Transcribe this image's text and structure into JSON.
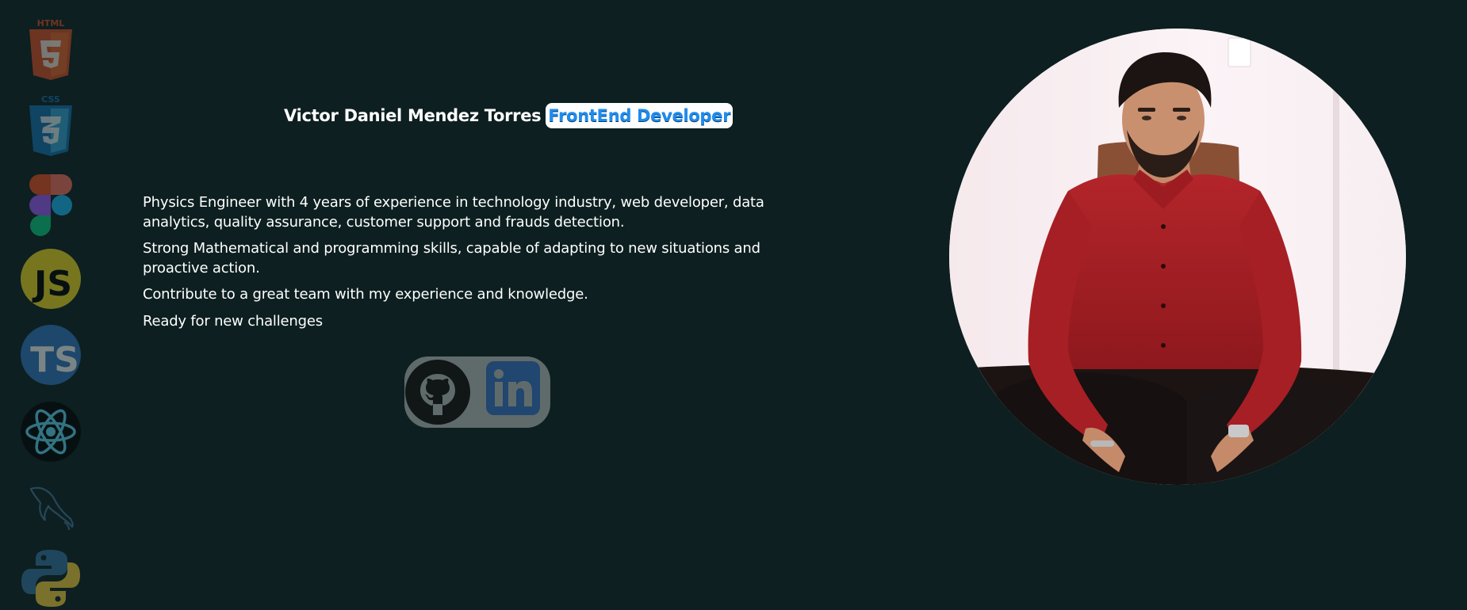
{
  "profile": {
    "name": "Victor Daniel Mendez Torres",
    "role": "FrontEnd Developer"
  },
  "bio": [
    "Physics Engineer with 4 years of experience in technology industry, web developer, data analytics, quality assurance, customer support and frauds detection.",
    "Strong Mathematical and programming skills, capable of adapting to new situations and proactive action.",
    "Contribute to a great team with my experience and knowledge.",
    "Ready for new challenges"
  ],
  "tech_stack": [
    {
      "icon": "html5-icon",
      "label": "HTML",
      "color": "#e34f26"
    },
    {
      "icon": "css3-icon",
      "label": "CSS",
      "color": "#1572b6"
    },
    {
      "icon": "figma-icon",
      "color": "#a259ff"
    },
    {
      "icon": "javascript-icon",
      "label": "JS",
      "color": "#f7df1e"
    },
    {
      "icon": "typescript-icon",
      "label": "TS",
      "color": "#3178c6"
    },
    {
      "icon": "react-icon",
      "color": "#61dafb"
    },
    {
      "icon": "mysql-icon",
      "color": "#4479a1"
    },
    {
      "icon": "python-icon",
      "color": "#3776ab"
    }
  ],
  "social": [
    {
      "icon": "github-icon"
    },
    {
      "icon": "linkedin-icon",
      "color": "#0a66c2"
    }
  ],
  "colors": {
    "background": "#0d1f20",
    "accent": "#1f8cf0",
    "social_pill": "#5f6b6b"
  }
}
